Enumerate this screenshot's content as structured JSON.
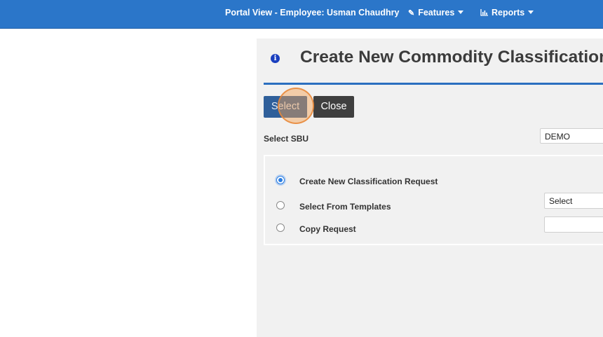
{
  "header": {
    "portal_view": "Portal View - Employee: Usman Chaudhry",
    "nav": [
      {
        "label": "Features",
        "icon": "pencil-icon"
      },
      {
        "label": "Reports",
        "icon": "bar-chart-icon"
      }
    ],
    "bar_color": "#2b76c9"
  },
  "dialog": {
    "title": "Create New Commodity Classification",
    "buttons": {
      "select_label": "Select",
      "close_label": "Close"
    },
    "sbu": {
      "label": "Select SBU",
      "value": "DEMO"
    },
    "options": [
      {
        "label": "Create New Classification Request",
        "checked": true
      },
      {
        "label": "Select From Templates",
        "checked": false,
        "field_value": "Select"
      },
      {
        "label": "Copy Request",
        "checked": false,
        "field_value": ""
      }
    ],
    "accent_color": "#2b6fc0"
  }
}
